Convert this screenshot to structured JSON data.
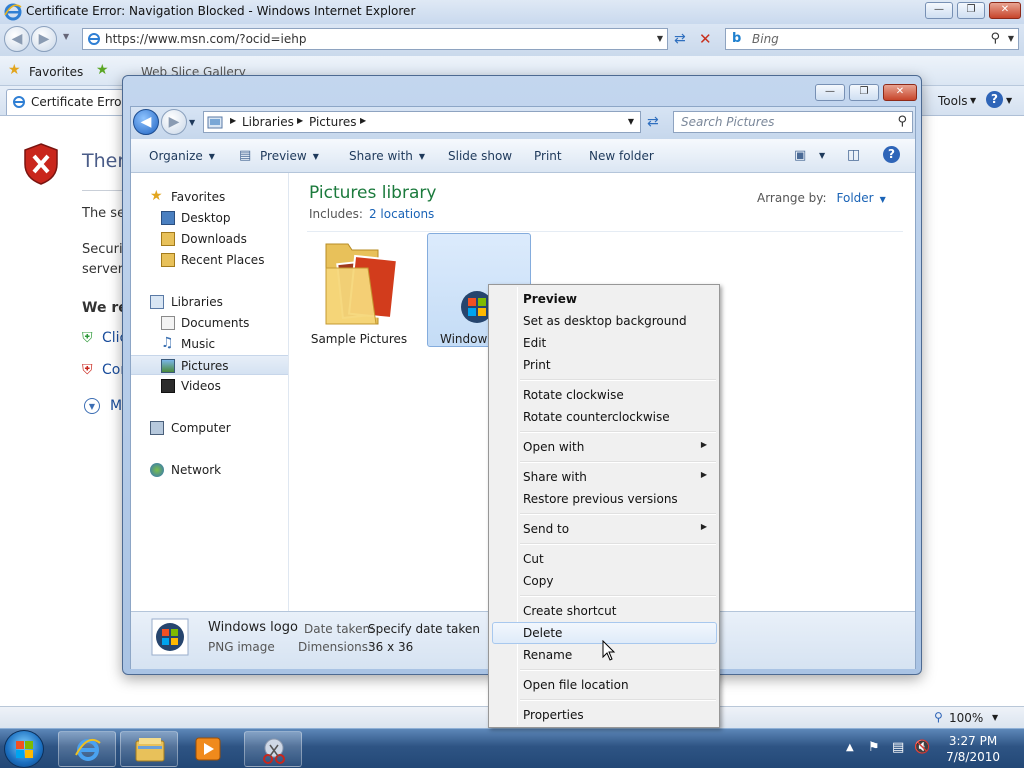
{
  "ie": {
    "title": "Certificate Error: Navigation Blocked - Windows Internet Explorer",
    "url": "https://www.msn.com/?ocid=iehp",
    "search_placeholder": "Bing",
    "favorites_label": "Favorites",
    "web_slice_label": "Web Slice Gallery",
    "tab_label": "Certificate Error: N",
    "tools_label": "Tools",
    "page_heading": "There",
    "body_line_1": "The se",
    "body_line_2": "Securit",
    "body_line_3": "server.",
    "body_bold": "We re",
    "link_1": "Clic",
    "link_2": "Cor",
    "more_info": "M",
    "zoom": "100%"
  },
  "explorer": {
    "breadcrumb": [
      "Libraries",
      "Pictures"
    ],
    "search_placeholder": "Search Pictures",
    "commands": [
      "Organize",
      "Preview",
      "Share with",
      "Slide show",
      "Print",
      "New folder"
    ],
    "nav": {
      "favorites": "Favorites",
      "favorites_items": [
        "Desktop",
        "Downloads",
        "Recent Places"
      ],
      "libraries": "Libraries",
      "libraries_items": [
        "Documents",
        "Music",
        "Pictures",
        "Videos"
      ],
      "computer": "Computer",
      "network": "Network"
    },
    "library_title": "Pictures library",
    "includes_label": "Includes:",
    "includes_link": "2 locations",
    "arrange_label": "Arrange by:",
    "arrange_value": "Folder",
    "files": [
      "Sample Pictures",
      "Windows"
    ],
    "details": {
      "name": "Windows logo",
      "type": "PNG image",
      "date_label": "Date taken:",
      "date_value": "Specify date taken",
      "dim_label": "Dimensions:",
      "dim_value": "36 x 36"
    }
  },
  "context_menu": {
    "items": [
      "Preview",
      "Set as desktop background",
      "Edit",
      "Print",
      "Rotate clockwise",
      "Rotate counterclockwise",
      "Open with",
      "Share with",
      "Restore previous versions",
      "Send to",
      "Cut",
      "Copy",
      "Create shortcut",
      "Delete",
      "Rename",
      "Open file location",
      "Properties"
    ]
  },
  "taskbar": {
    "time": "3:27 PM",
    "date": "7/8/2010"
  },
  "colors": {
    "library_title": "#1b7a3c",
    "link": "#1a63b6",
    "selection": "#c4dcf6"
  }
}
